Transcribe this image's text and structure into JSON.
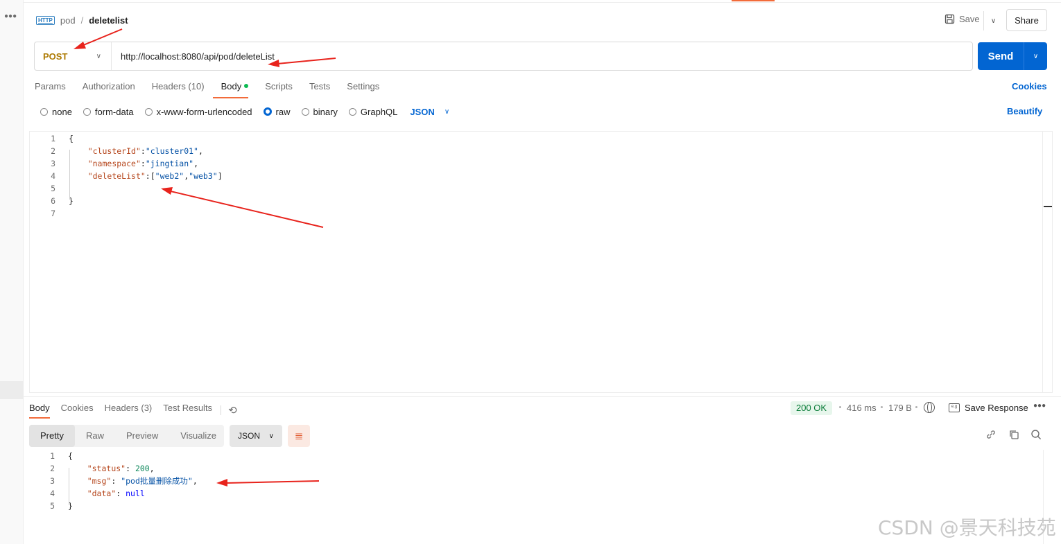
{
  "breadcrumb": {
    "collection": "pod",
    "separator": "/",
    "request": "deletelist"
  },
  "header": {
    "save_label": "Save",
    "share_label": "Share"
  },
  "request": {
    "method": "POST",
    "url": "http://localhost:8080/api/pod/deleteList",
    "send_label": "Send"
  },
  "request_tabs": [
    {
      "label": "Params"
    },
    {
      "label": "Authorization"
    },
    {
      "label": "Headers (10)"
    },
    {
      "label": "Body",
      "active": true
    },
    {
      "label": "Scripts"
    },
    {
      "label": "Tests"
    },
    {
      "label": "Settings"
    }
  ],
  "cookies_label": "Cookies",
  "body_options": {
    "none": "none",
    "form_data": "form-data",
    "urlencoded": "x-www-form-urlencoded",
    "raw": "raw",
    "binary": "binary",
    "graphql": "GraphQL",
    "selected": "raw",
    "format": "JSON"
  },
  "beautify_label": "Beautify",
  "request_body": {
    "line_numbers": [
      "1",
      "2",
      "3",
      "4",
      "5",
      "6",
      "7"
    ],
    "l1": "{",
    "k1": "\"clusterId\"",
    "v1": "\"cluster01\"",
    "k2": "\"namespace\"",
    "v2": "\"jingtian\"",
    "k3": "\"deleteList\"",
    "v3a": "\"web2\"",
    "v3b": "\"web3\"",
    "close": "}"
  },
  "response_tabs": [
    {
      "label": "Body",
      "active": true
    },
    {
      "label": "Cookies"
    },
    {
      "label": "Headers (3)"
    },
    {
      "label": "Test Results"
    }
  ],
  "response_meta": {
    "status": "200 OK",
    "time": "416 ms",
    "size": "179 B",
    "save_response_label": "Save Response"
  },
  "response_view": {
    "modes": [
      "Pretty",
      "Raw",
      "Preview",
      "Visualize"
    ],
    "active": "Pretty",
    "format": "JSON"
  },
  "response_body": {
    "line_numbers": [
      "1",
      "2",
      "3",
      "4",
      "5"
    ],
    "open": "{",
    "k1": "\"status\"",
    "v1": "200",
    "k2": "\"msg\"",
    "v2": "\"pod批量删除成功\"",
    "k3": "\"data\"",
    "v3": "null",
    "close": "}"
  },
  "watermark": "CSDN @景天科技苑",
  "colors": {
    "accent": "#0265d2",
    "method": "#ad7a03",
    "tab_underline": "#f26b3a",
    "status_ok": "#067a35",
    "annotation_arrow": "#e8231c"
  }
}
